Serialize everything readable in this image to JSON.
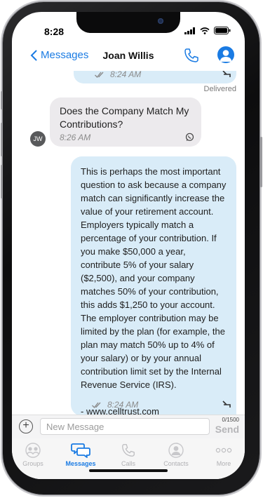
{
  "status": {
    "time": "8:28"
  },
  "header": {
    "back_label": "Messages",
    "title": "Joan Willis"
  },
  "messages": {
    "previous": {
      "time": "8:24 AM",
      "status": "Delivered"
    },
    "incoming": {
      "avatar_initials": "JW",
      "text": "Does the Company Match My Contributions?",
      "time": "8:26 AM"
    },
    "outgoing": {
      "text": "This is perhaps the most important question to ask because a company match can significantly increase the value of your retirement account. Employers typically match a percentage of your contribution. If you make $50,000 a year, contribute 5% of your salary ($2,500), and your company matches 50% of your contribution, this adds $1,250 to your account. The employer contribution may be limited by the plan (for example, the plan may match 50% up to 4% of your salary) or by your annual contribution limit set by the Internal Revenue Service (IRS).",
      "signature_prefix": "- ",
      "signature_link": "www.celltrust.com",
      "time": "8:24 AM"
    }
  },
  "composer": {
    "placeholder": "New Message",
    "counter": "0/1500",
    "send_label": "Send"
  },
  "tabs": [
    {
      "label": "Groups",
      "icon": "groups-icon"
    },
    {
      "label": "Messages",
      "icon": "messages-icon",
      "active": true
    },
    {
      "label": "Calls",
      "icon": "phone-icon"
    },
    {
      "label": "Contacts",
      "icon": "contact-icon"
    },
    {
      "label": "More",
      "icon": "more-icon"
    }
  ],
  "colors": {
    "accent": "#1a7be3",
    "outgoing_bubble": "#d9ecf8",
    "incoming_bubble": "#eceaed"
  }
}
